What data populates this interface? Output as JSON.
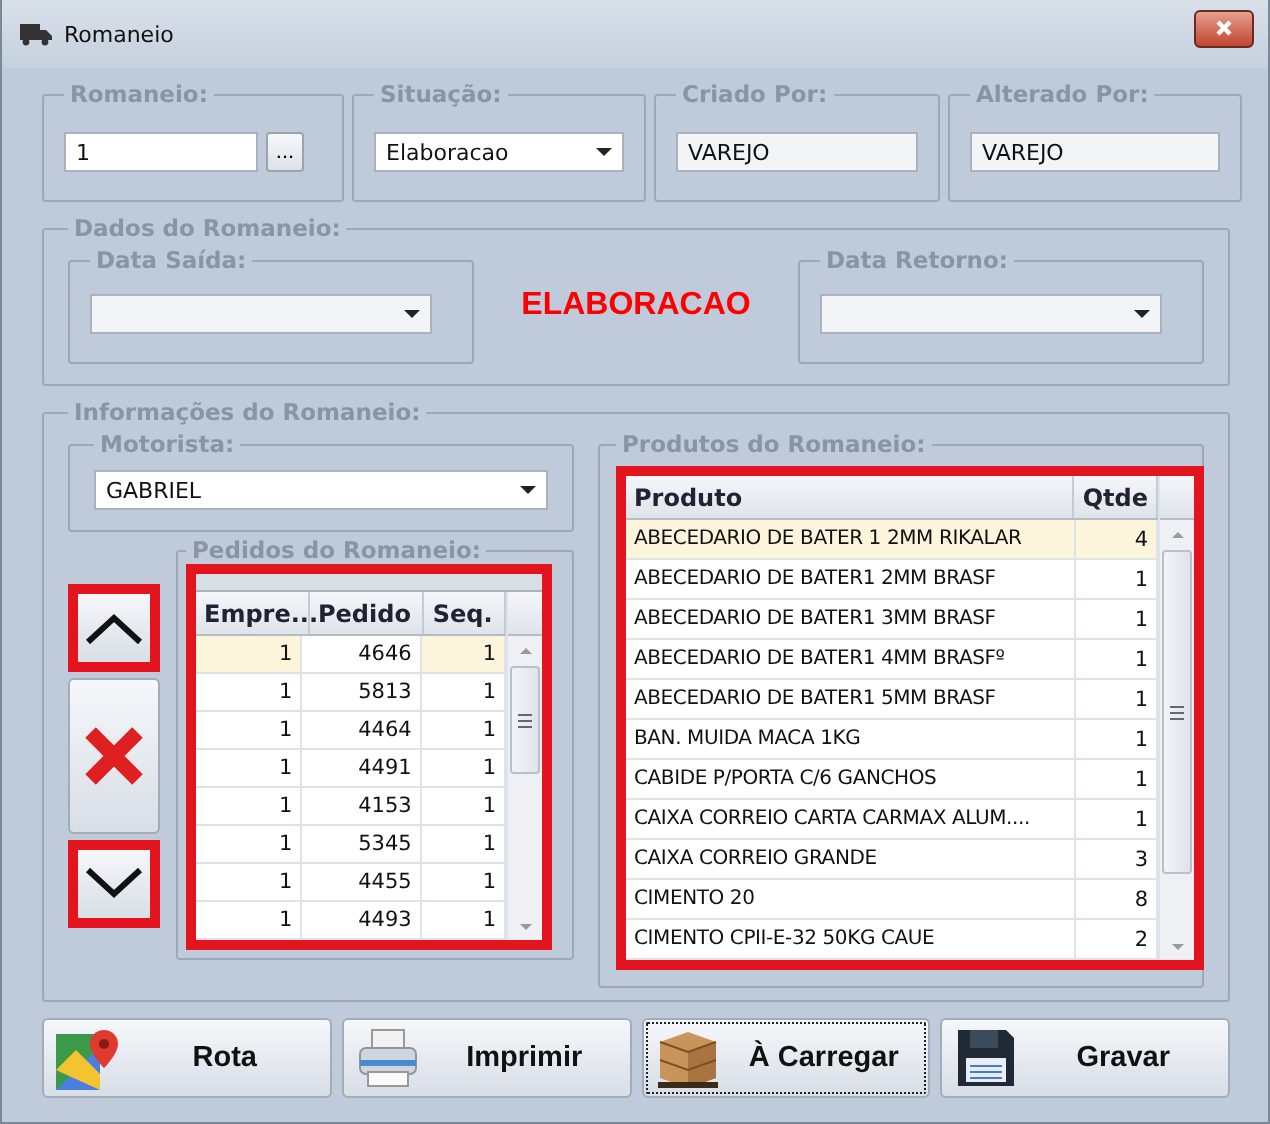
{
  "window": {
    "title": "Romaneio"
  },
  "header_fields": [
    {
      "label": "Romaneio:",
      "kind": "lookup",
      "value": "1",
      "button": "...",
      "readonly": false
    },
    {
      "label": "Situação:",
      "kind": "dropdown",
      "value": "Elaboracao",
      "readonly": false
    },
    {
      "label": "Criado Por:",
      "kind": "text",
      "value": "VAREJO",
      "readonly": true
    },
    {
      "label": "Alterado Por:",
      "kind": "text",
      "value": "VAREJO",
      "readonly": true
    }
  ],
  "dados": {
    "title": "Dados do Romaneio:",
    "data_saida": {
      "label": "Data Saída:"
    },
    "status": "ELABORACAO",
    "data_retorno": {
      "label": "Data Retorno:"
    }
  },
  "informacoes": {
    "title": "Informações do Romaneio:",
    "motorista": {
      "label": "Motorista:",
      "value": "GABRIEL"
    },
    "side_buttons": [
      {
        "kind": "up",
        "highlighted": true
      },
      {
        "kind": "delete",
        "highlighted": false
      },
      {
        "kind": "down",
        "highlighted": true
      }
    ],
    "pedidos": {
      "title": "Pedidos do Romaneio:",
      "highlighted": true,
      "columns": [
        "Empre...",
        "Pedido",
        "Seq."
      ],
      "rows": [
        {
          "cells": [
            "1",
            "4646",
            "1"
          ],
          "selected": true
        },
        {
          "cells": [
            "1",
            "5813",
            "1"
          ],
          "selected": false
        },
        {
          "cells": [
            "1",
            "4464",
            "1"
          ],
          "selected": false
        },
        {
          "cells": [
            "1",
            "4491",
            "1"
          ],
          "selected": false
        },
        {
          "cells": [
            "1",
            "4153",
            "1"
          ],
          "selected": false
        },
        {
          "cells": [
            "1",
            "5345",
            "1"
          ],
          "selected": false
        },
        {
          "cells": [
            "1",
            "4455",
            "1"
          ],
          "selected": false
        },
        {
          "cells": [
            "1",
            "4493",
            "1"
          ],
          "selected": false
        }
      ]
    },
    "produtos": {
      "title": "Produtos do Romaneio:",
      "highlighted": true,
      "columns": [
        "Produto",
        "Qtde"
      ],
      "rows": [
        {
          "cells": [
            "ABECEDARIO DE BATER 1 2MM RIKALAR",
            "4"
          ],
          "selected": true
        },
        {
          "cells": [
            "ABECEDARIO DE BATER1 2MM BRASF",
            "1"
          ],
          "selected": false
        },
        {
          "cells": [
            "ABECEDARIO DE BATER1 3MM BRASF",
            "1"
          ],
          "selected": false
        },
        {
          "cells": [
            "ABECEDARIO DE BATER1 4MM BRASFº",
            "1"
          ],
          "selected": false
        },
        {
          "cells": [
            "ABECEDARIO DE BATER1 5MM BRASF",
            "1"
          ],
          "selected": false
        },
        {
          "cells": [
            "BAN. MUIDA MACA 1KG",
            "1"
          ],
          "selected": false
        },
        {
          "cells": [
            "CABIDE P/PORTA C/6 GANCHOS",
            "1"
          ],
          "selected": false
        },
        {
          "cells": [
            "CAIXA CORREIO CARTA CARMAX ALUM....",
            "1"
          ],
          "selected": false
        },
        {
          "cells": [
            "CAIXA CORREIO GRANDE",
            "3"
          ],
          "selected": false
        },
        {
          "cells": [
            "CIMENTO 20",
            "8"
          ],
          "selected": false
        },
        {
          "cells": [
            "CIMENTO CPII-E-32 50KG CAUE",
            "2"
          ],
          "selected": false
        }
      ]
    }
  },
  "buttons": [
    {
      "label": "Rota",
      "kind": "map",
      "focused": false
    },
    {
      "label": "Imprimir",
      "kind": "print",
      "focused": false
    },
    {
      "label": "À Carregar",
      "kind": "boxes",
      "focused": true
    },
    {
      "label": "Gravar",
      "kind": "save",
      "focused": false
    }
  ]
}
